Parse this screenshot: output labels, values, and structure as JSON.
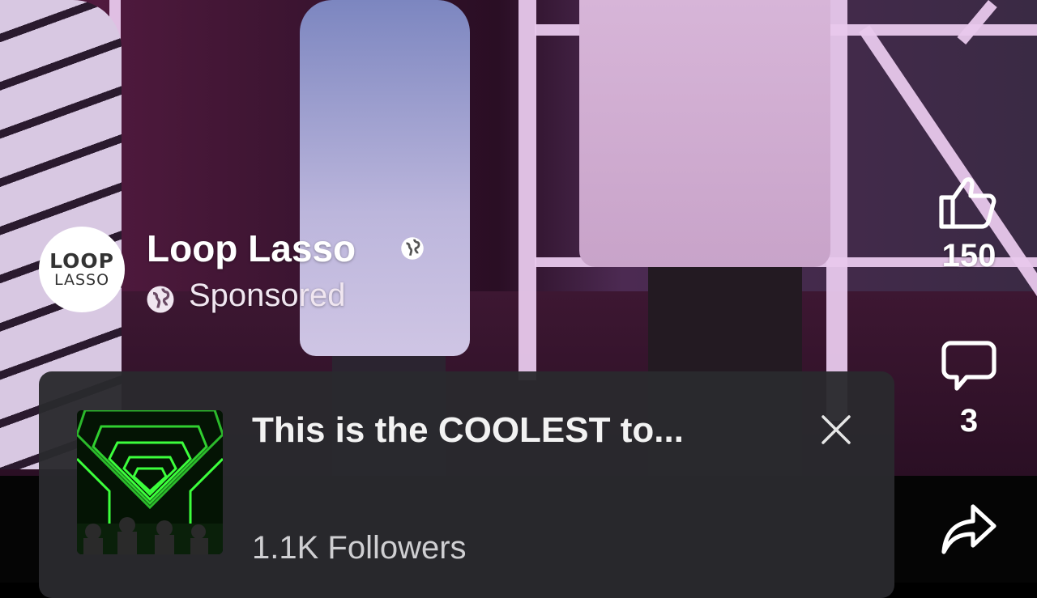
{
  "post": {
    "page_logo": {
      "line1": "LOOP",
      "line2": "LASSO"
    },
    "page_name": "Loop Lasso",
    "sponsored_label": "Sponsored"
  },
  "actions": {
    "like_count": "150",
    "comment_count": "3"
  },
  "ad_card": {
    "title": "This is the COOLEST to...",
    "followers": "1.1K Followers"
  },
  "colors": {
    "card_bg": "#2a2a2e",
    "text": "#ffffff",
    "secondary_text": "#cfcfd2"
  },
  "icons": [
    "globe-icon",
    "like-icon",
    "comment-icon",
    "share-icon",
    "close-icon"
  ]
}
